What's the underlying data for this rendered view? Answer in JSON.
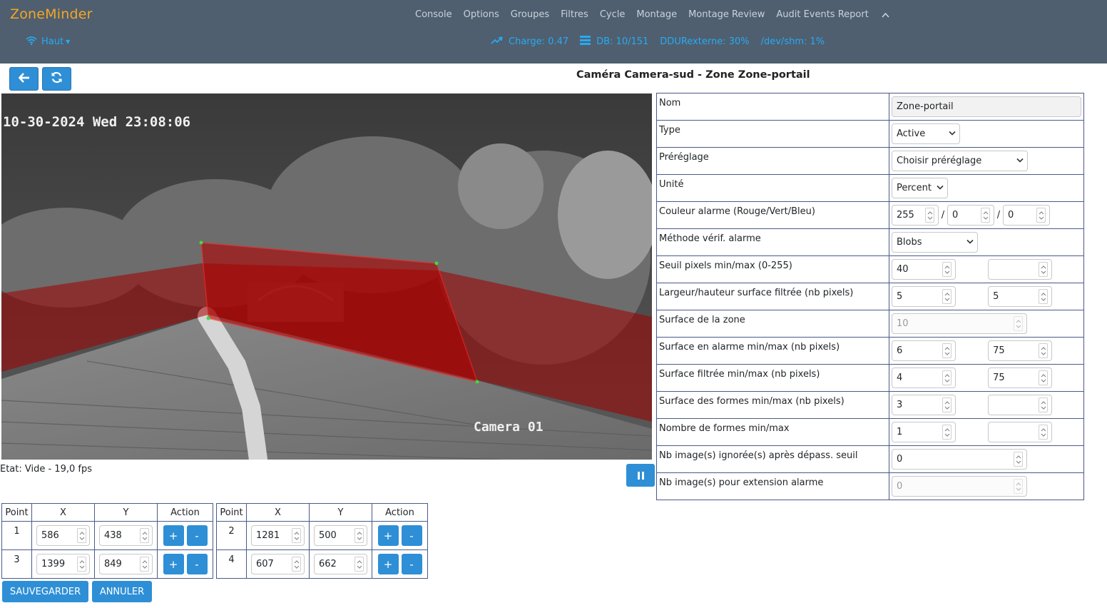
{
  "brand": "ZoneMinder",
  "nav": {
    "items": [
      "Console",
      "Options",
      "Groupes",
      "Filtres",
      "Cycle",
      "Montage",
      "Montage Review",
      "Audit Events Report"
    ]
  },
  "header": {
    "haut_label": "Haut",
    "stats": {
      "charge": "Charge: 0.47",
      "db": "DB: 10/151",
      "disk": "DDURexterne: 30%",
      "shm": "/dev/shm: 1%"
    }
  },
  "page_title": "Caméra Camera-sud - Zone Zone-portail",
  "camera": {
    "timestamp_overlay": "10-30-2024 Wed 23:08:06",
    "name_overlay": "Camera 01",
    "status": "Etat: Vide - 19,0 fps"
  },
  "points_table": {
    "headers": [
      "Point",
      "X",
      "Y",
      "Action"
    ],
    "points": [
      {
        "id": "1",
        "x": "586",
        "y": "438"
      },
      {
        "id": "2",
        "x": "1281",
        "y": "500"
      },
      {
        "id": "3",
        "x": "1399",
        "y": "849"
      },
      {
        "id": "4",
        "x": "607",
        "y": "662"
      }
    ],
    "add_label": "+",
    "remove_label": "-"
  },
  "buttons": {
    "save": "SAUVEGARDER",
    "cancel": "ANNULER"
  },
  "zone_form": {
    "nom": {
      "label": "Nom",
      "value": "Zone-portail"
    },
    "type": {
      "label": "Type",
      "value": "Active"
    },
    "preset": {
      "label": "Préréglage",
      "value": "Choisir préréglage"
    },
    "unit": {
      "label": "Unité",
      "value": "Percent"
    },
    "alarm_color": {
      "label": "Couleur alarme (Rouge/Vert/Bleu)",
      "r": "255",
      "g": "0",
      "b": "0"
    },
    "check_method": {
      "label": "Méthode vérif. alarme",
      "value": "Blobs"
    },
    "pixel_threshold": {
      "label": "Seuil pixels min/max (0-255)",
      "min": "40",
      "max": ""
    },
    "filter_size": {
      "label": "Largeur/hauteur surface filtrée (nb pixels)",
      "width": "5",
      "height": "5"
    },
    "zone_area": {
      "label": "Surface de la zone",
      "value": "10"
    },
    "alarm_area": {
      "label": "Surface en alarme min/max (nb pixels)",
      "min": "6",
      "max": "75"
    },
    "filtered_area": {
      "label": "Surface filtrée min/max (nb pixels)",
      "min": "4",
      "max": "75"
    },
    "blob_area": {
      "label": "Surface des formes min/max (nb pixels)",
      "min": "3",
      "max": ""
    },
    "blob_count": {
      "label": "Nombre de formes min/max",
      "min": "1",
      "max": ""
    },
    "overload_frames": {
      "label": "Nb image(s) ignorée(s) après dépass. seuil",
      "value": "0"
    },
    "extend_alarm_frames": {
      "label": "Nb image(s) pour extension alarme",
      "value": "0"
    }
  },
  "colors": {
    "header_bg": "#4f5f6f",
    "brand": "#f5a623",
    "accent": "#2e8fd6",
    "link": "#27aaf2",
    "zone_fill": "#c00000"
  },
  "icons": {
    "back": "arrow-left-icon",
    "refresh": "refresh-icon",
    "haut": "wifi-icon",
    "charge": "trending-up-icon",
    "db": "list-icon",
    "pause": "pause-icon",
    "nav_toggle": "chevron-up-icon"
  }
}
